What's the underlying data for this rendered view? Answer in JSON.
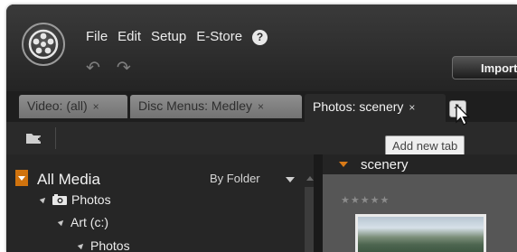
{
  "menu": {
    "items": [
      {
        "label": "File"
      },
      {
        "label": "Edit"
      },
      {
        "label": "Setup"
      },
      {
        "label": "E-Store"
      }
    ],
    "help_icon": "?"
  },
  "toolbar": {
    "undo_icon": "undo-icon",
    "redo_icon": "redo-icon",
    "import_label": "Import"
  },
  "tabs": [
    {
      "label": "Video: (all)",
      "close": "×",
      "active": false
    },
    {
      "label": "Disc Menus: Medley",
      "close": "×",
      "active": false
    },
    {
      "label": "Photos: scenery",
      "close": "×",
      "active": true
    }
  ],
  "add_tab": {
    "label": "+",
    "tooltip": "Add new tab"
  },
  "library": {
    "title": "All Media",
    "group_by": "By Folder",
    "tree": [
      {
        "label": "Photos",
        "level": 1
      },
      {
        "label": "Art (c:)",
        "level": 2
      },
      {
        "label": "Photos",
        "level": 3
      }
    ]
  },
  "browser": {
    "title": "scenery",
    "rating": "★★★★★"
  },
  "colors": {
    "accent": "#d97a17",
    "window_bg": "#2e2e2e",
    "tab_inactive": "#808080"
  }
}
